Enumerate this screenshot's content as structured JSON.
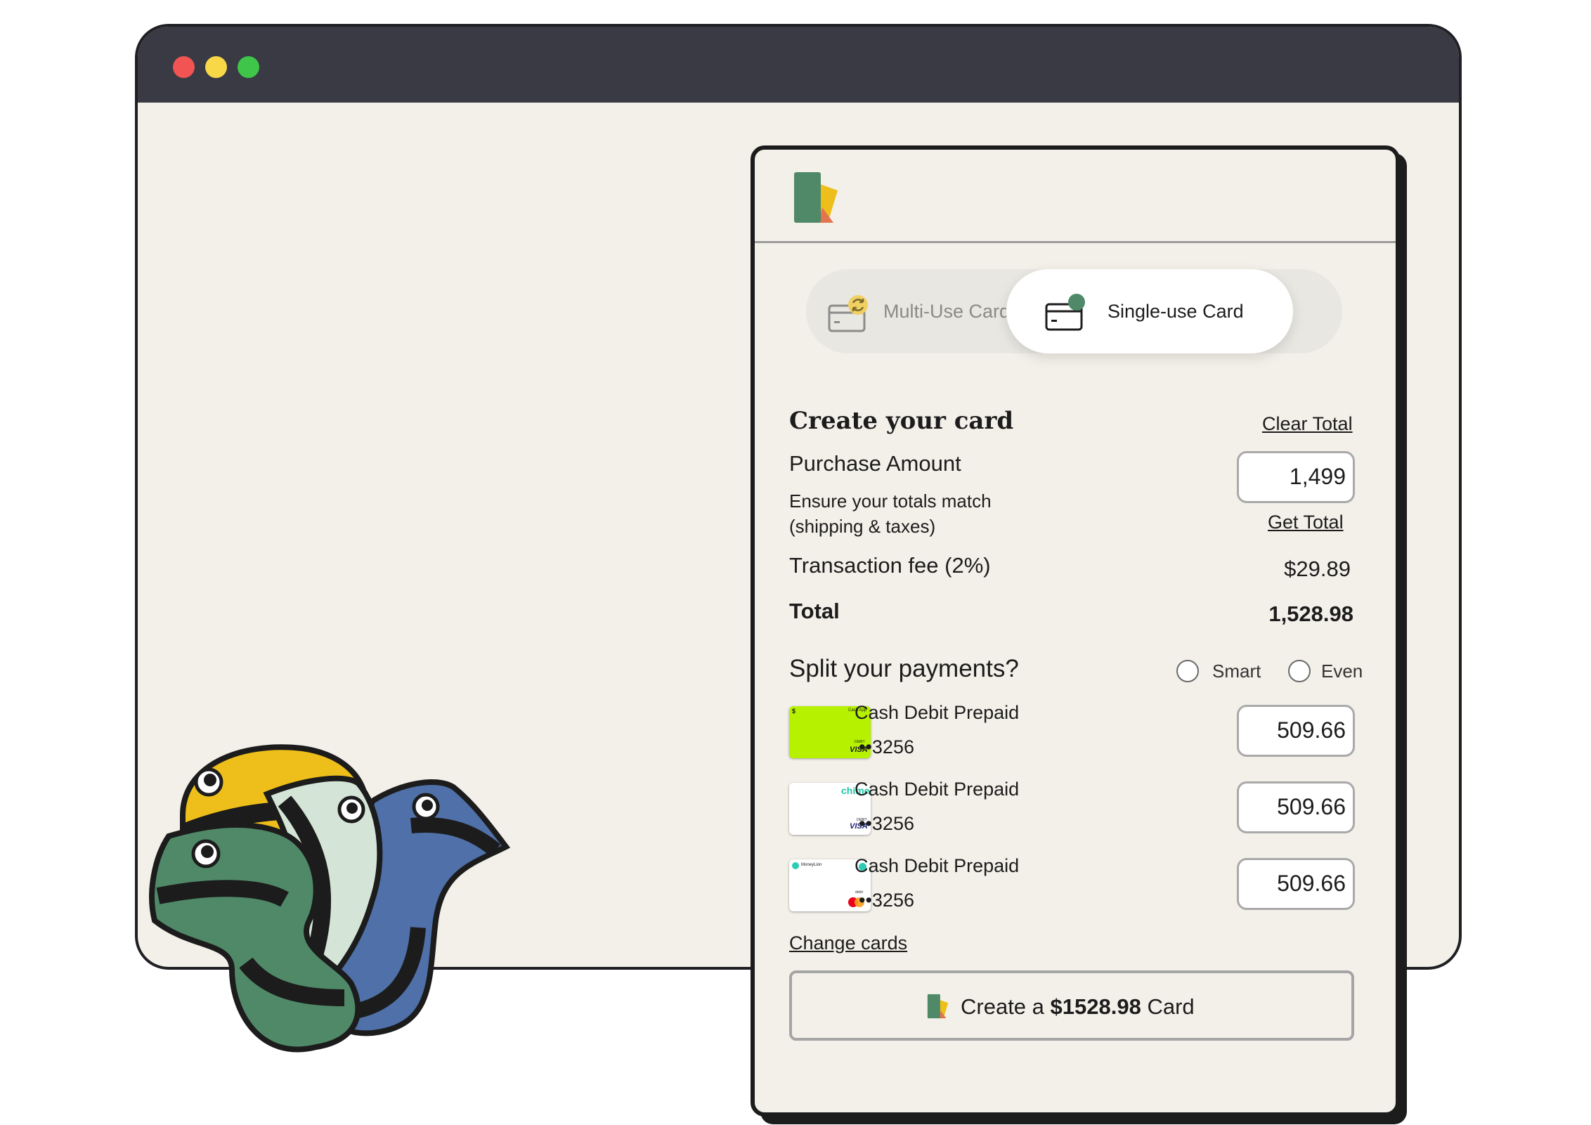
{
  "colors": {
    "browser_bar": "#393a43",
    "traffic_red": "#f25454",
    "traffic_yellow": "#f9d848",
    "traffic_green": "#3ec54a",
    "brand_green": "#4f8968",
    "brand_yellow": "#eebf1a",
    "brand_orange": "#e2754f",
    "mascot_blue": "#4f70a8",
    "mascot_mint": "#d4e5d8"
  },
  "browser": {
    "controls": [
      "close",
      "minimize",
      "maximize"
    ]
  },
  "tabs": {
    "multi": {
      "label": "Multi-Use Card",
      "icon": "card-refresh-icon"
    },
    "single": {
      "label": "Single-use Card",
      "icon": "card-dot-icon",
      "selected": true
    }
  },
  "create": {
    "title": "Create your card",
    "clear_total": "Clear Total",
    "purchase_label": "Purchase Amount",
    "purchase_value": "1,499",
    "note_line1": "Ensure your totals match",
    "note_line2": "(shipping & taxes)",
    "get_total": "Get Total",
    "fee_label": "Transaction fee (2%)",
    "fee_value": "$29.89",
    "total_label": "Total",
    "total_value": "1,528.98"
  },
  "split": {
    "title": "Split your payments?",
    "options": [
      "Smart",
      "Even"
    ],
    "cards": [
      {
        "name": "Cash Debit Prepaid",
        "last4": "••3256",
        "amount": "509.66",
        "brand": "cash-app",
        "network": "VISA"
      },
      {
        "name": "Cash Debit Prepaid",
        "last4": "••3256",
        "amount": "509.66",
        "brand": "chime",
        "network": "VISA"
      },
      {
        "name": "Cash Debit Prepaid",
        "last4": "••3256",
        "amount": "509.66",
        "brand": "moneylion",
        "network": "mastercard"
      }
    ],
    "card_texts": {
      "cashapp_top": "Cash App",
      "cashapp_sign": "$",
      "cashapp_debit": "DEBIT",
      "visa": "VISA",
      "chime": "chime",
      "chime_debit": "DEBIT",
      "moneylion": "MoneyLion",
      "moneylion_debit": "debit"
    },
    "change_cards": "Change cards"
  },
  "button": {
    "prefix": "Create a",
    "amount": "$1528.98",
    "suffix": "Card"
  }
}
